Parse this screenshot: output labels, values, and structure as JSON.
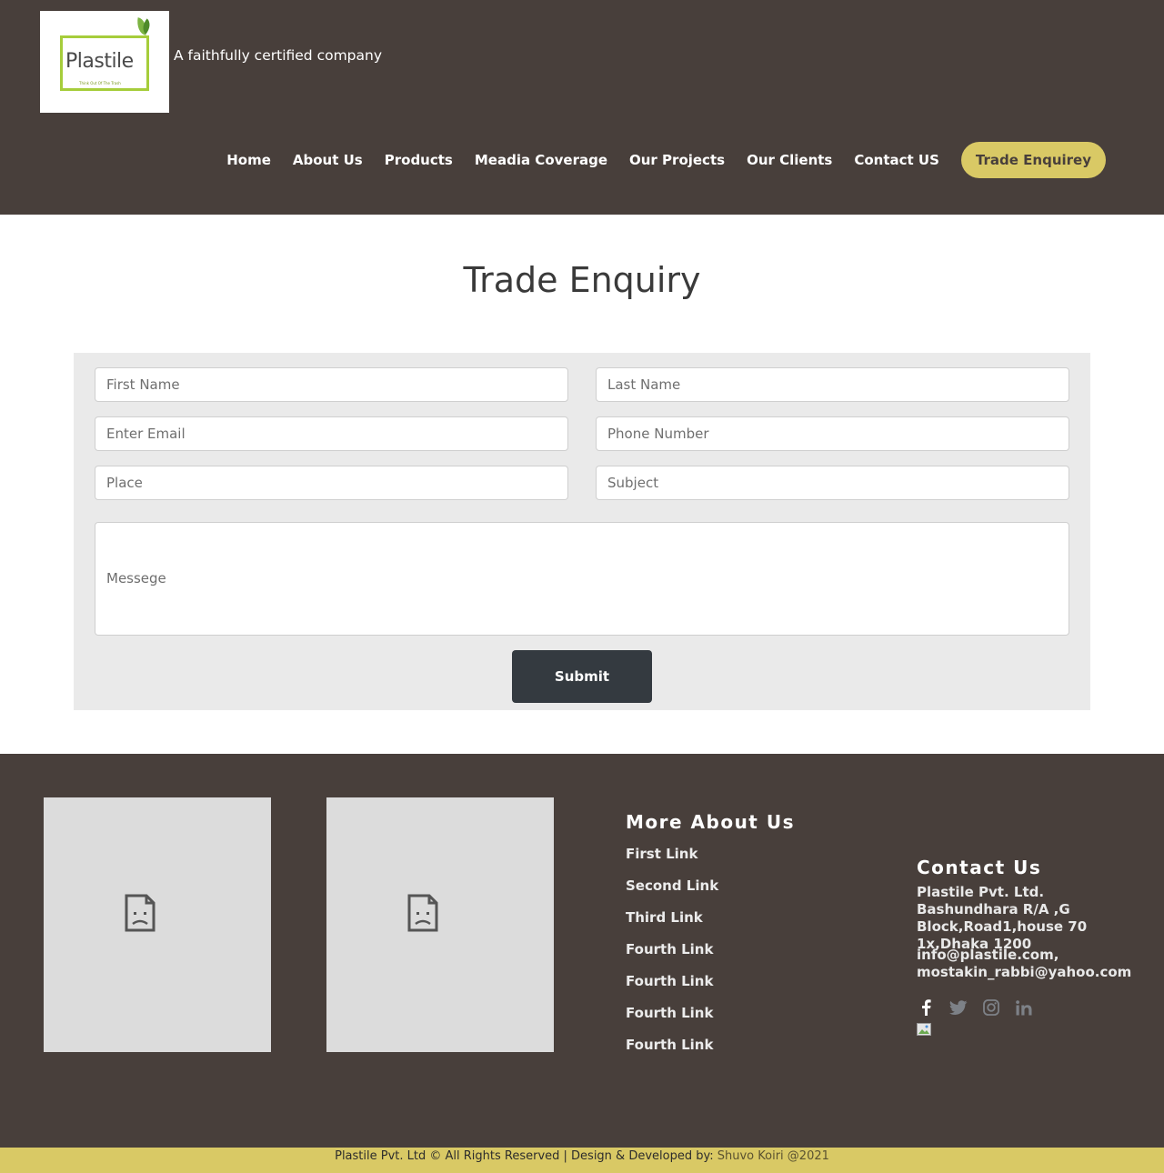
{
  "header": {
    "logo": {
      "text": "Plastile",
      "tagline_small": "Think Out Of The Trash"
    },
    "tagline": "A faithfully certified company",
    "nav": [
      "Home",
      "About Us",
      "Products",
      "Meadia Coverage",
      "Our Projects",
      "Our Clients",
      "Contact US"
    ],
    "cta": "Trade Enquirey",
    "colors": {
      "background": "#483f3b",
      "accent": "#d9c965"
    }
  },
  "main": {
    "title": "Trade Enquiry",
    "form": {
      "first_name_placeholder": "First Name",
      "last_name_placeholder": "Last Name",
      "email_placeholder": "Enter Email",
      "phone_placeholder": "Phone Number",
      "place_placeholder": "Place",
      "subject_placeholder": "Subject",
      "message_placeholder": "Messege",
      "submit_label": "Submit"
    }
  },
  "footer": {
    "more_title": "More About Us",
    "links": [
      "First Link",
      "Second Link",
      "Third Link",
      "Fourth Link",
      "Fourth Link",
      "Fourth Link",
      "Fourth Link"
    ],
    "contact_title": "Contact Us",
    "address": "Plastile Pvt. Ltd. Bashundhara R/A ,G Block,Road1,house 70 1x,Dhaka 1200",
    "emails": "info@plastile.com, mostakin_rabbi@yahoo.com",
    "socials": [
      "facebook-icon",
      "twitter-icon",
      "instagram-icon",
      "linkedin-icon"
    ],
    "copyright": "Plastile Pvt. Ltd © All Rights Reserved | Design & Developed by: ",
    "developer": "Shuvo Koiri @2021"
  }
}
